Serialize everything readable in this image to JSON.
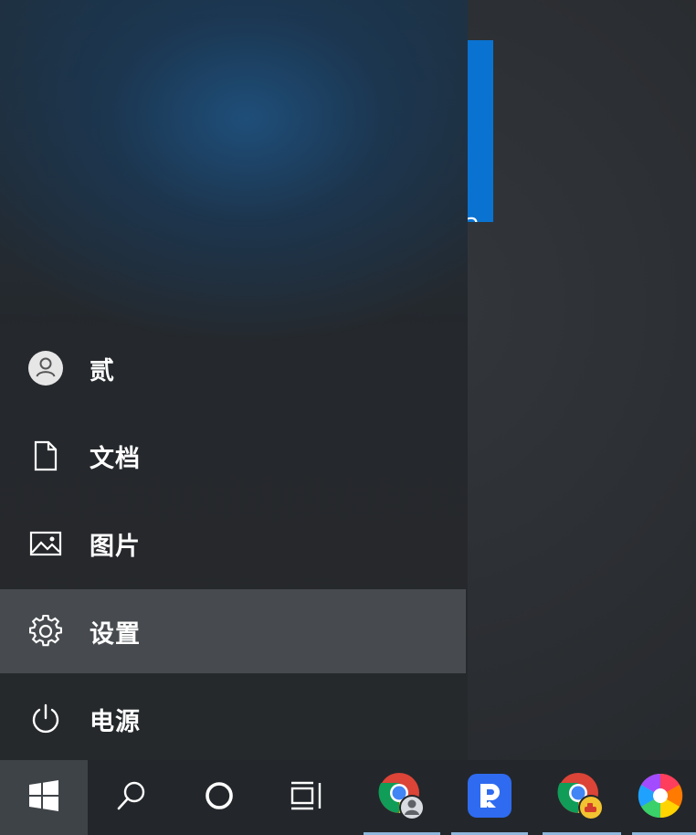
{
  "start_menu": {
    "items": [
      {
        "label": "贰",
        "icon": "user-avatar-icon"
      },
      {
        "label": "文档",
        "icon": "document-icon"
      },
      {
        "label": "图片",
        "icon": "picture-icon"
      },
      {
        "label": "设置",
        "icon": "gear-icon",
        "highlighted": true
      },
      {
        "label": "电源",
        "icon": "power-icon"
      }
    ]
  },
  "tile": {
    "glyph": "a",
    "color": "#0a73d1"
  },
  "taskbar": {
    "buttons": [
      {
        "icon": "windows-start-icon"
      },
      {
        "icon": "search-icon"
      },
      {
        "icon": "cortana-icon"
      },
      {
        "icon": "task-view-icon"
      },
      {
        "icon": "chrome-profile-person-icon"
      },
      {
        "icon": "blue-r-app-icon"
      },
      {
        "icon": "chrome-profile-car-icon"
      },
      {
        "icon": "colorful-pinwheel-app-icon"
      }
    ]
  },
  "colors": {
    "highlight": "#474b4f",
    "taskbar": "#23272b",
    "accent_blue": "#0a73d1"
  }
}
